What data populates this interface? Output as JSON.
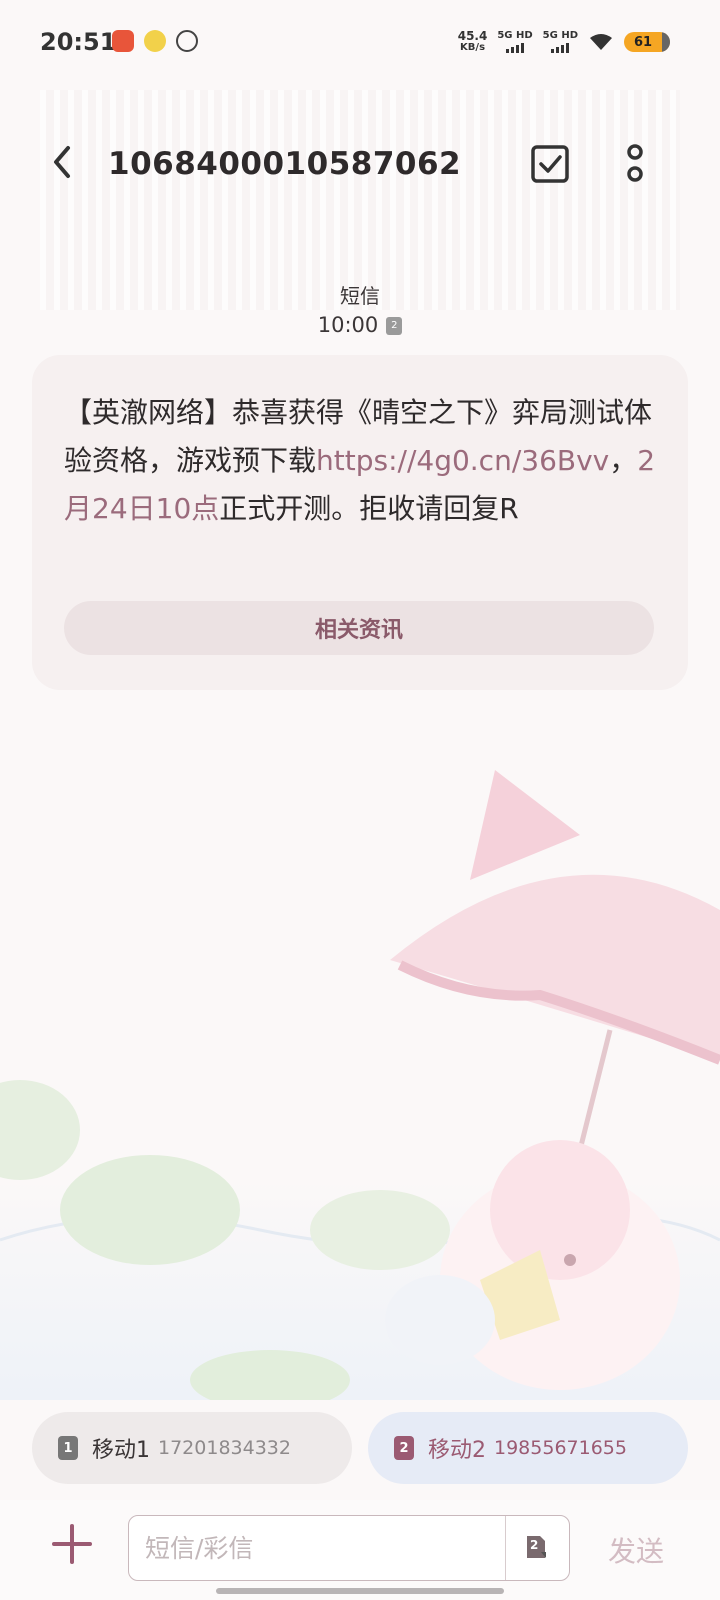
{
  "status_bar": {
    "time": "20:51",
    "net_speed_value": "45.4",
    "net_speed_unit": "KB/s",
    "signal_1": "5G HD",
    "signal_2": "5G HD",
    "battery": "61"
  },
  "header": {
    "title": "1068400010587062"
  },
  "meta": {
    "type_label": "短信",
    "time": "10:00",
    "sim_badge": "2"
  },
  "message": {
    "text_part1": "【英澈网络】恭喜获得《晴空之下》弈局测试体验资格，游戏预下载",
    "link": "https://4g0.cn/36Bvv",
    "separator": "，",
    "date_link": "2月24日10点",
    "text_part2": "正式开测。拒收请回复R",
    "related_button": "相关资讯"
  },
  "sim_selector": {
    "sim1": {
      "badge": "1",
      "name": "移动1",
      "number": "17201834332"
    },
    "sim2": {
      "badge": "2",
      "name": "移动2",
      "number": "19855671655"
    }
  },
  "composer": {
    "placeholder": "短信/彩信",
    "sim_badge": "2",
    "send_label": "发送"
  },
  "colors": {
    "accent": "#9b5a72",
    "link": "#9b6b7c",
    "bubble": "#f6f0f0"
  }
}
